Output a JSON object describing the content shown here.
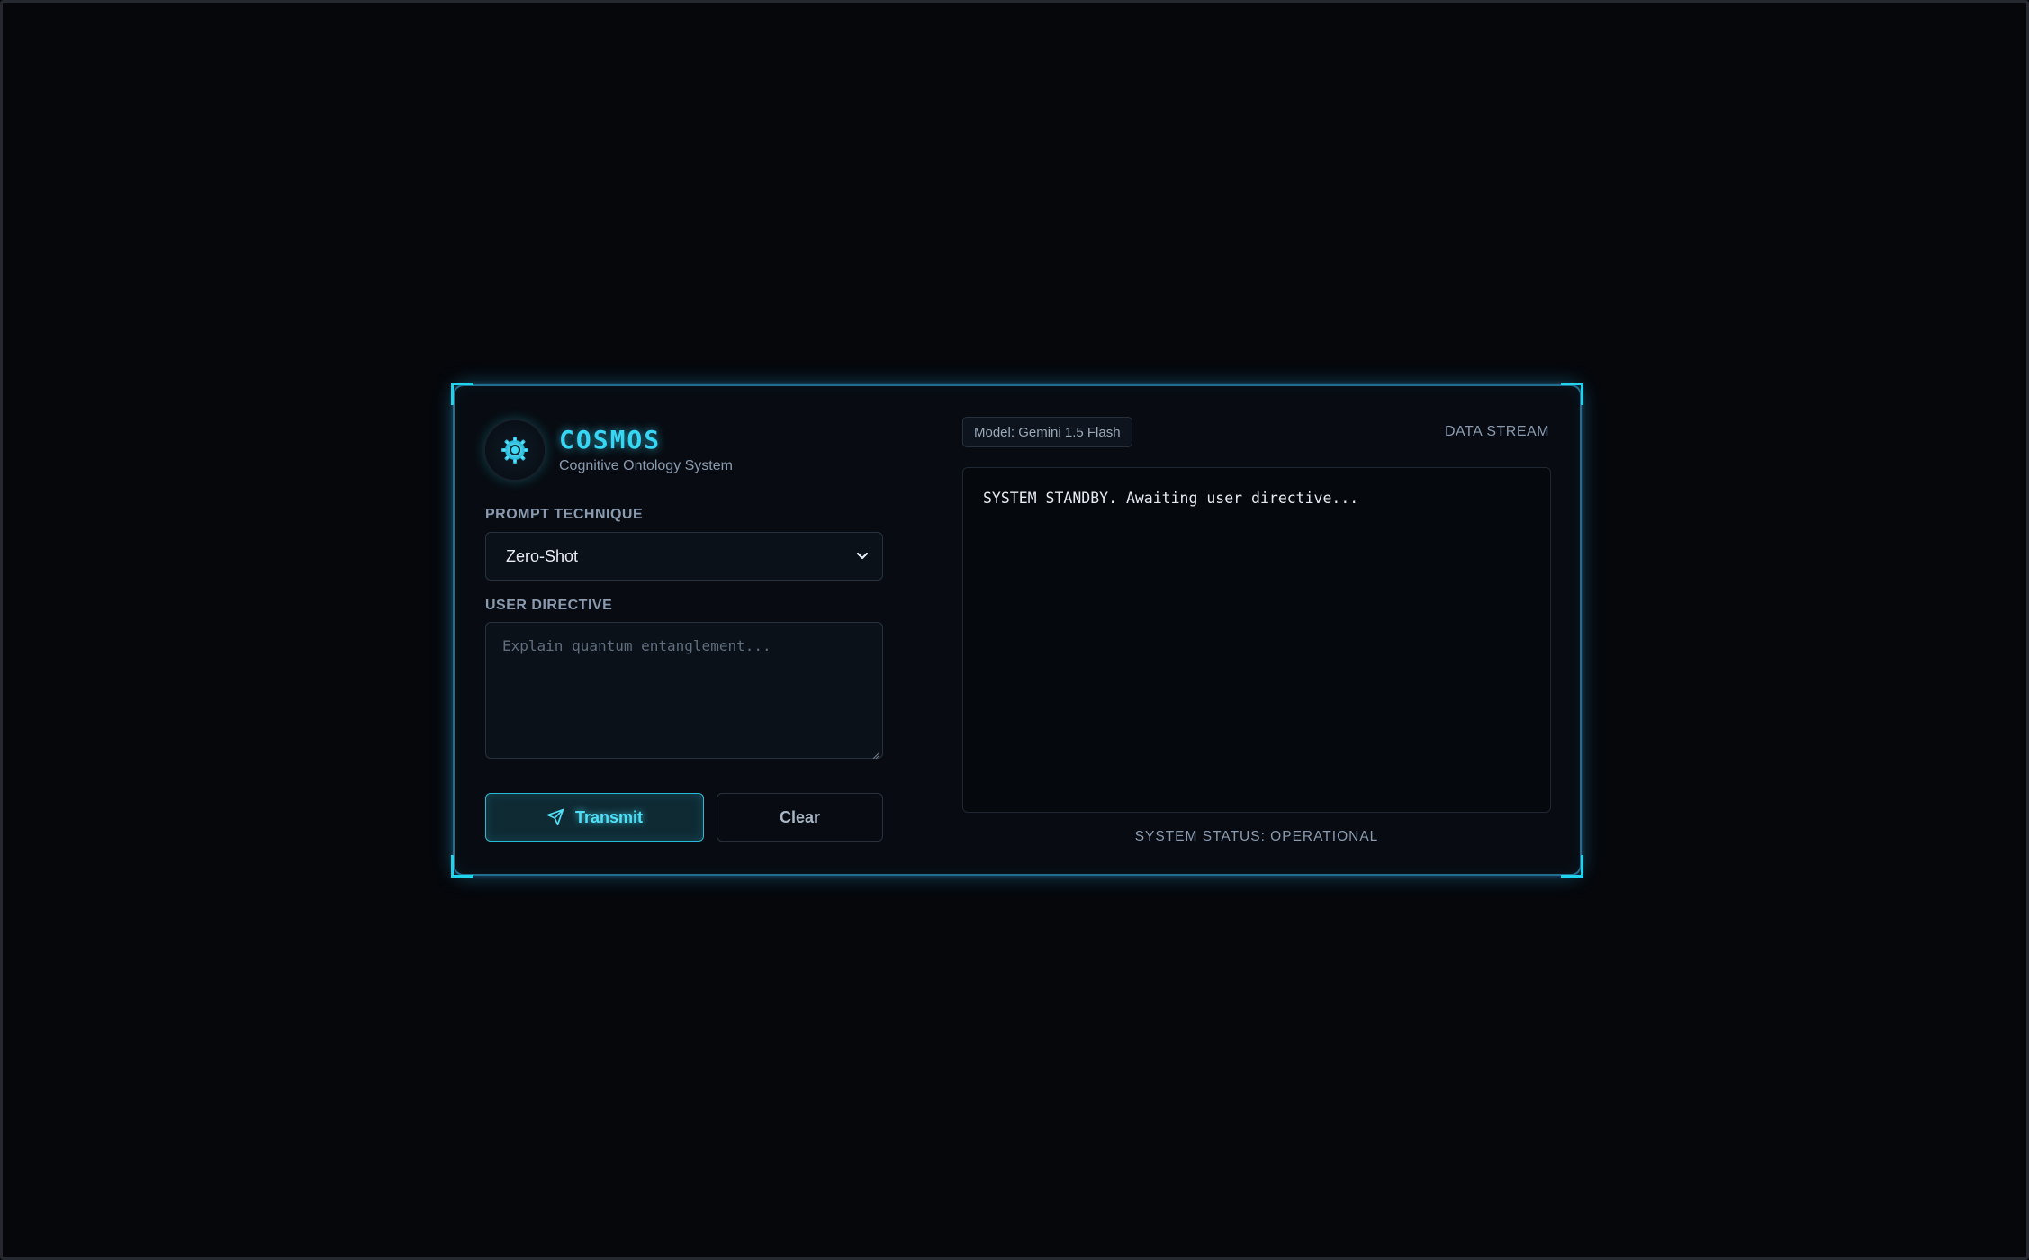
{
  "app": {
    "title": "COSMOS",
    "subtitle": "Cognitive Ontology System",
    "logo_icon": "gear-icon",
    "accent_color": "#38d6f5"
  },
  "form": {
    "technique_label": "PROMPT TECHNIQUE",
    "technique_value": "Zero-Shot",
    "directive_label": "USER DIRECTIVE",
    "directive_value": "",
    "directive_placeholder": "Explain quantum entanglement..."
  },
  "actions": {
    "transmit_label": "Transmit",
    "transmit_icon": "send-icon",
    "clear_label": "Clear"
  },
  "output": {
    "model_badge": "Model: Gemini 1.5 Flash",
    "stream_label": "DATA STREAM",
    "text": "SYSTEM STANDBY. Awaiting user directive...",
    "status": "SYSTEM STATUS: OPERATIONAL"
  }
}
